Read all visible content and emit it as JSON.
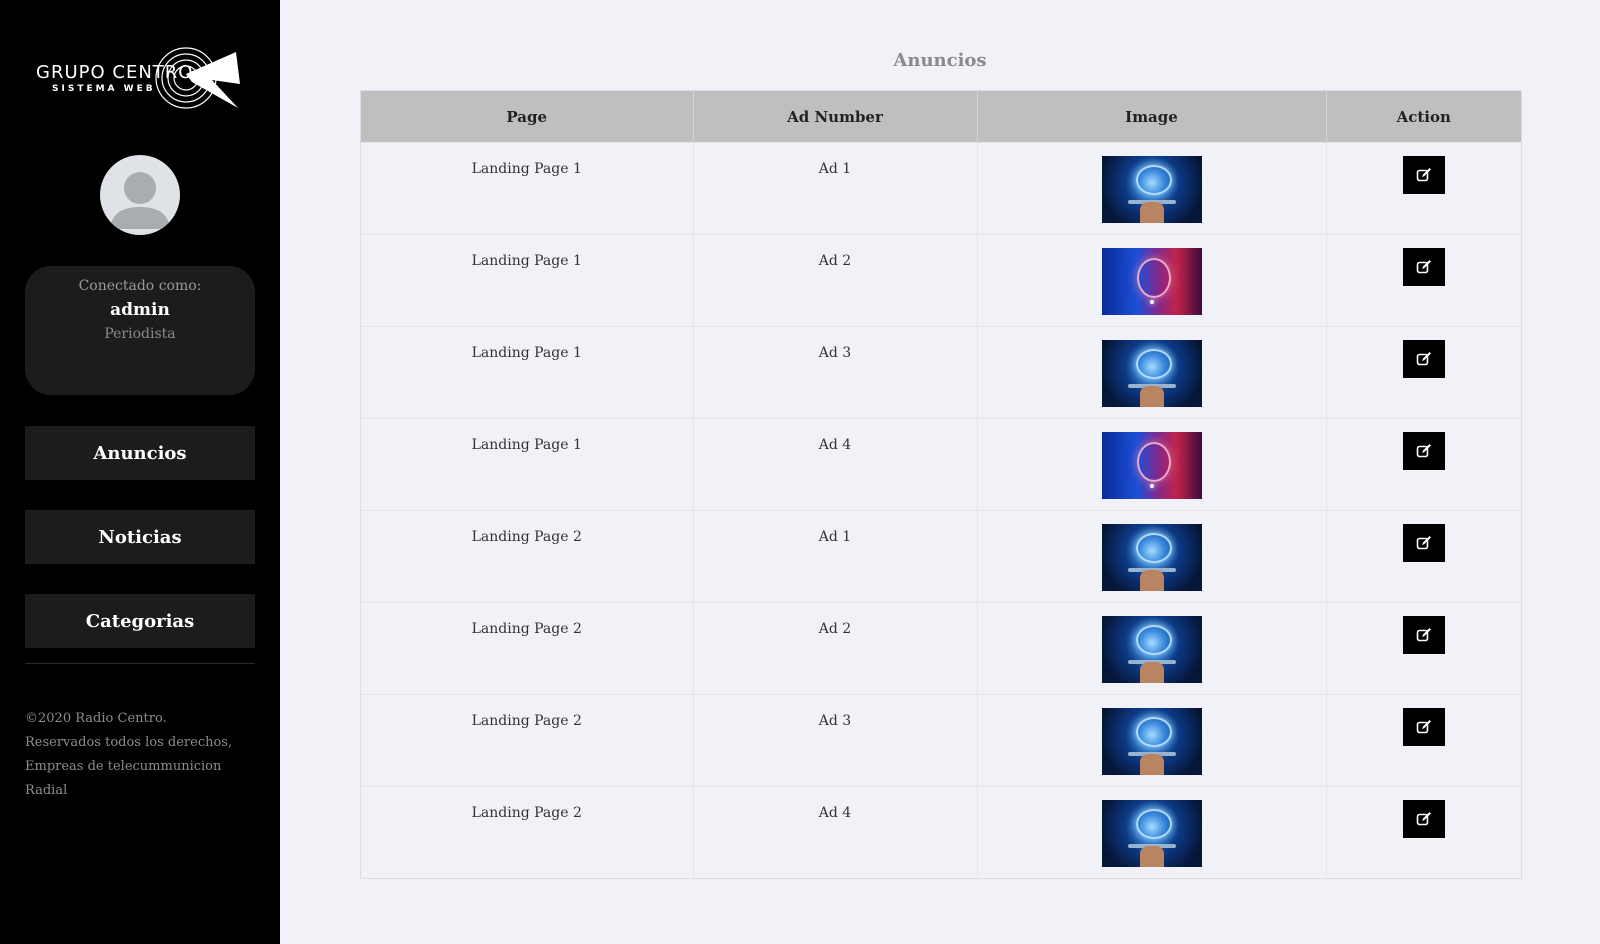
{
  "brand": {
    "name": "GRUPO CENTRO",
    "subtitle": "SISTEMA WEB"
  },
  "user": {
    "connected_label": "Conectado como:",
    "username": "admin",
    "role": "Periodista"
  },
  "nav": {
    "items": [
      {
        "label": "Anuncios"
      },
      {
        "label": "Noticias"
      },
      {
        "label": "Categorias"
      }
    ]
  },
  "footer": {
    "line1": "©2020 Radio Centro.",
    "line2": "Reservados todos los derechos,",
    "line3": "Empreas de telecummunicion Radial"
  },
  "main": {
    "title": "Anuncios",
    "columns": [
      "Page",
      "Ad Number",
      "Image",
      "Action"
    ],
    "rows": [
      {
        "page": "Landing Page 1",
        "ad": "Ad 1",
        "image": "brain-hand"
      },
      {
        "page": "Landing Page 1",
        "ad": "Ad 2",
        "image": "brain-red-blue"
      },
      {
        "page": "Landing Page 1",
        "ad": "Ad 3",
        "image": "brain-hand"
      },
      {
        "page": "Landing Page 1",
        "ad": "Ad 4",
        "image": "brain-red-blue"
      },
      {
        "page": "Landing Page 2",
        "ad": "Ad 1",
        "image": "brain-hand"
      },
      {
        "page": "Landing Page 2",
        "ad": "Ad 2",
        "image": "brain-hand"
      },
      {
        "page": "Landing Page 2",
        "ad": "Ad 3",
        "image": "brain-hand"
      },
      {
        "page": "Landing Page 2",
        "ad": "Ad 4",
        "image": "brain-hand"
      }
    ],
    "action_icon": "edit-icon"
  },
  "colors": {
    "sidebar_bg": "#000000",
    "card_bg": "#1b1c1e",
    "content_bg": "#f0f2f7",
    "header_bg": "#bfbfbf"
  }
}
